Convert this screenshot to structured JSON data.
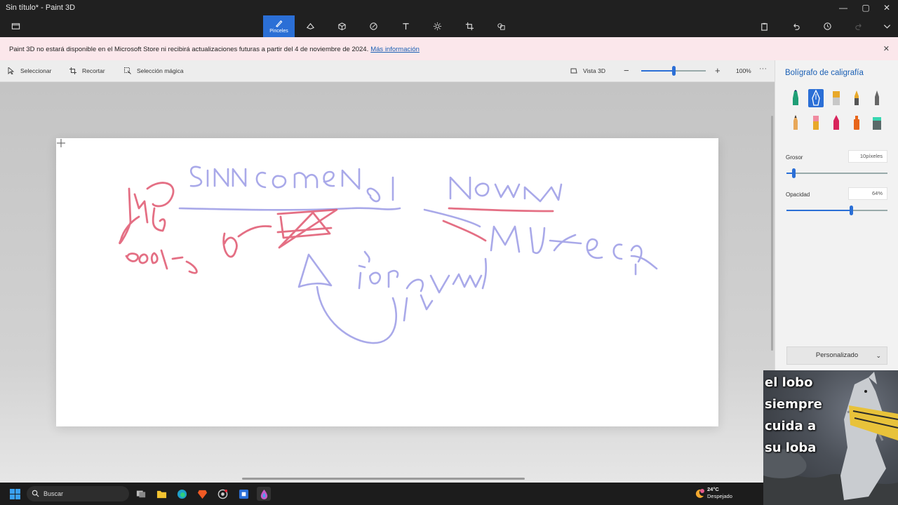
{
  "window": {
    "title": "Sin título* - Paint 3D"
  },
  "commandbar": {
    "active_tab_label": "Pinceles",
    "tabs": [
      "brushes-icon",
      "2d-shapes-icon",
      "3d-shapes-icon",
      "stickers-icon",
      "text-icon",
      "effects-icon",
      "canvas-icon",
      "3d-library-icon"
    ]
  },
  "banner": {
    "message": "Paint 3D no estará disponible en el Microsoft Store ni recibirá actualizaciones futuras a partir del 4 de noviembre de 2024.",
    "link": "Más información"
  },
  "toolbar": {
    "select": "Seleccionar",
    "crop": "Recortar",
    "magic_select": "Selección mágica",
    "view3d": "Vista 3D",
    "zoom_level": "100%",
    "zoom_fraction": 0.5
  },
  "panel": {
    "title": "Bolígrafo de caligrafía",
    "thickness_label": "Grosor",
    "thickness_value": "10píxeles",
    "thickness_fraction": 0.07,
    "opacity_label": "Opacidad",
    "opacity_value": "64%",
    "opacity_fraction": 0.64,
    "preset": "Personalizado",
    "brushes": [
      "marker",
      "calligraphy-pen",
      "oil-brush",
      "watercolor",
      "pixel-pen",
      "pencil",
      "eraser",
      "crayon",
      "spraycan",
      "fill"
    ],
    "selected_brush": "calligraphy-pen"
  },
  "meme": {
    "lines": [
      "el lobo",
      "siempre",
      "cuida a",
      "su loba"
    ]
  },
  "taskbar": {
    "search": "Buscar",
    "temperature": "24°C",
    "weather": "Despejado"
  },
  "colors": {
    "accent": "#2b6fd6",
    "ink_blue": "#9b9be6",
    "ink_red": "#e0576f"
  }
}
